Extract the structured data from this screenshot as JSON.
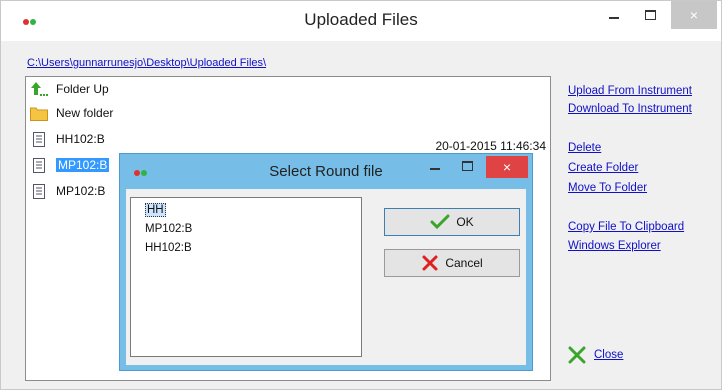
{
  "window": {
    "title": "Uploaded Files",
    "path": "C:\\Users\\gunnarrunesjo\\Desktop\\Uploaded Files\\",
    "controls": {
      "minimize": "minimize-icon",
      "maximize": "maximize-icon",
      "close_glyph": "×"
    }
  },
  "files": [
    {
      "name": "Folder Up",
      "icon": "folder-up-icon",
      "date": ""
    },
    {
      "name": "New folder",
      "icon": "folder-icon",
      "date": ""
    },
    {
      "name": "HH102:B",
      "icon": "file-icon",
      "date": "20-01-2015 11:46:34"
    },
    {
      "name": "MP102:B",
      "icon": "file-icon",
      "selected": true
    },
    {
      "name": "MP102:B",
      "icon": "file-icon"
    }
  ],
  "actions": {
    "upload": "Upload From Instrument",
    "download": "Download To Instrument",
    "delete": "Delete",
    "create_folder": "Create Folder",
    "move_folder": "Move To Folder",
    "copy_clipboard": "Copy File To Clipboard",
    "explorer": "Windows Explorer",
    "close": "Close"
  },
  "dialog": {
    "title": "Select Round file",
    "items": [
      "HH",
      "MP102:B",
      "HH102:B"
    ],
    "selected_item": "HH",
    "ok": "OK",
    "cancel": "Cancel",
    "close_glyph": "×"
  },
  "colors": {
    "link": "#1010c8",
    "selection": "#3399ff",
    "dialog_frame": "#76bde8",
    "close_red": "#e04343",
    "ok_green": "#3aa52b",
    "cancel_red": "#e02020"
  }
}
